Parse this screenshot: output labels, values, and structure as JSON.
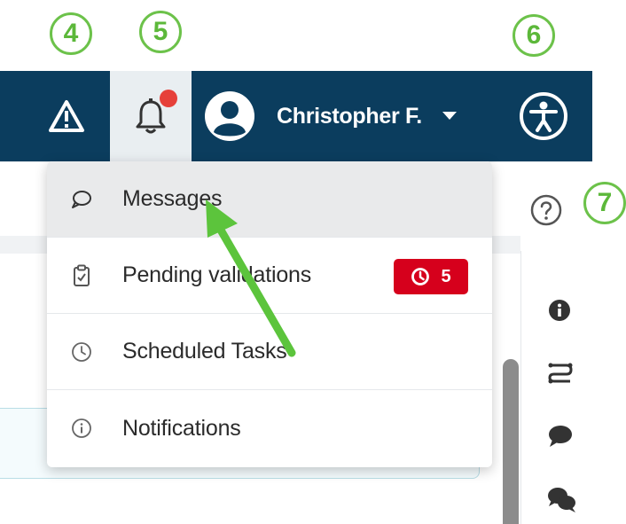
{
  "callouts": [
    "4",
    "5",
    "6",
    "7"
  ],
  "header": {
    "user_name": "Christopher F.",
    "icons": [
      "warning-icon",
      "bell-icon",
      "user-avatar-icon",
      "chevron-down-icon",
      "accessibility-icon"
    ],
    "notification_dot_color": "#e6403a",
    "background_color": "#0b3d5e"
  },
  "menu": {
    "items": [
      {
        "label": "Messages",
        "icon": "chat-bubble-icon"
      },
      {
        "label": "Pending validations",
        "icon": "clipboard-check-icon",
        "badge_count": "5",
        "badge_icon": "clock-icon"
      },
      {
        "label": "Scheduled Tasks",
        "icon": "clock-icon"
      },
      {
        "label": "Notifications",
        "icon": "info-icon"
      }
    ]
  },
  "colors": {
    "callout": "#6cc24a",
    "arrow": "#6cc24a",
    "badge": "#d6001c"
  },
  "sidebar_icons": [
    "info-icon",
    "route-icon",
    "comment-icon",
    "comments-icon"
  ]
}
